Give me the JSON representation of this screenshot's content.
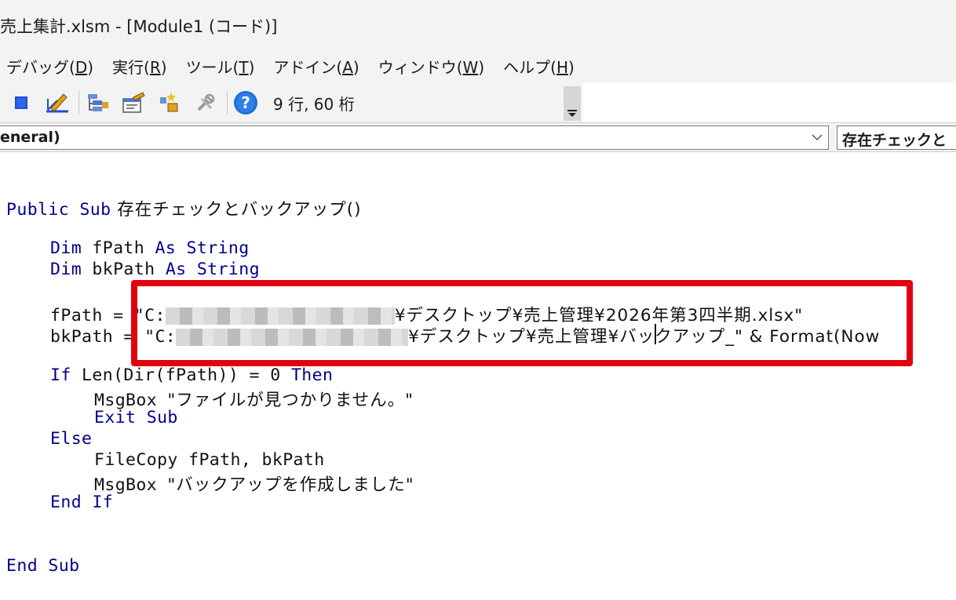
{
  "window": {
    "title": "売上集計.xlsm - [Module1 (コード)]"
  },
  "menu": {
    "items": [
      {
        "pre": "デバッグ(",
        "acc": "D",
        "post": ")"
      },
      {
        "pre": "実行(",
        "acc": "R",
        "post": ")"
      },
      {
        "pre": "ツール(",
        "acc": "T",
        "post": ")"
      },
      {
        "pre": "アドイン(",
        "acc": "A",
        "post": ")"
      },
      {
        "pre": "ウィンドウ(",
        "acc": "W",
        "post": ")"
      },
      {
        "pre": "ヘルプ(",
        "acc": "H",
        "post": ")"
      }
    ]
  },
  "toolbar": {
    "icons": [
      "reset-icon",
      "design-mode-icon",
      "project-explorer-icon",
      "properties-window-icon",
      "object-browser-icon",
      "toolbox-icon",
      "help-icon"
    ],
    "status": "9 行, 60 桁",
    "colors": {
      "stop": "#1f4fd0",
      "help": "#1f6fd6"
    }
  },
  "combos": {
    "object": "eneral)",
    "procedure": "存在チェックと"
  },
  "code": {
    "sub_open": {
      "kw1": "Public Sub",
      "name": " 存在チェックとバックアップ()"
    },
    "dim1": {
      "kw1": "Dim",
      "var": " fPath ",
      "kw2": "As String"
    },
    "dim2": {
      "kw1": "Dim",
      "var": " bkPath ",
      "kw2": "As String"
    },
    "assign1": {
      "lhs": "fPath = ",
      "q": "\"C:",
      "path": "¥デスクトップ¥売上管理¥2026年第3四半期.xlsx\""
    },
    "assign2": {
      "lhs": "bkPath = ",
      "q": "\"C:",
      "path": "¥デスクトップ¥売上管理¥バックアップ_\" & Format(Now"
    },
    "if_line": {
      "kw1": "If",
      "mid": " Len(Dir(fPath)) = 0 ",
      "kw2": "Then"
    },
    "msg1": {
      "fn": "MsgBox ",
      "str": "\"ファイルが見つかりません。\""
    },
    "exit_sub": "Exit Sub",
    "else": "Else",
    "filecopy": "FileCopy fPath, bkPath",
    "msg2": {
      "fn": "MsgBox ",
      "str": "\"バックアップを作成しました\""
    },
    "end_if": "End If",
    "end_sub": "End Sub"
  },
  "accent": {
    "keyword": "#00008b",
    "highlight_box": "#e00010"
  }
}
